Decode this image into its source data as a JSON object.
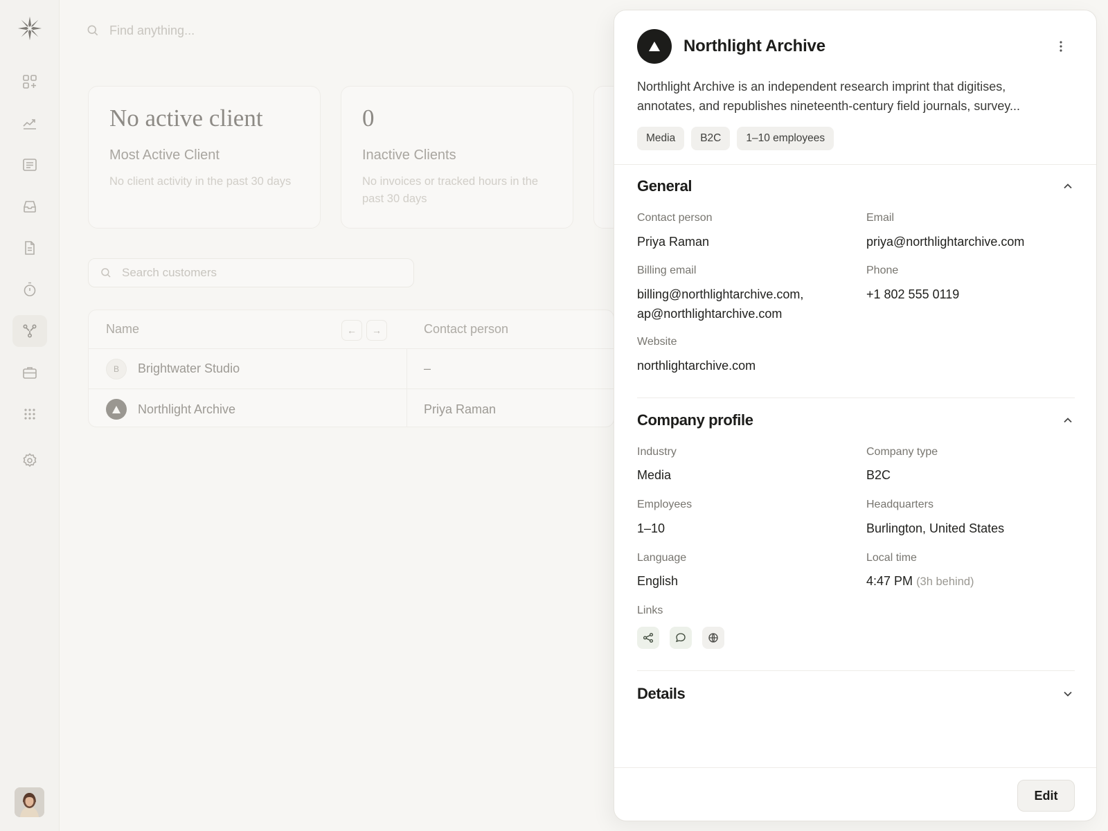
{
  "sidebar": {
    "items": [
      {
        "name": "dashboard",
        "icon": "widgets-icon"
      },
      {
        "name": "reports",
        "icon": "trend-chart-icon"
      },
      {
        "name": "notes",
        "icon": "document-lines-icon"
      },
      {
        "name": "inbox",
        "icon": "inbox-tray-icon"
      },
      {
        "name": "invoices",
        "icon": "file-icon"
      },
      {
        "name": "time-tracking",
        "icon": "stopwatch-icon"
      },
      {
        "name": "customers",
        "icon": "network-nodes-icon",
        "active": true
      },
      {
        "name": "projects",
        "icon": "briefcase-icon"
      },
      {
        "name": "apps",
        "icon": "grid-dots-icon"
      },
      {
        "name": "settings",
        "icon": "gear-icon"
      }
    ]
  },
  "search": {
    "placeholder": "Find anything..."
  },
  "stats": [
    {
      "value": "No active client",
      "label": "Most Active Client",
      "sub": "No client activity in the past 30 days"
    },
    {
      "value": "0",
      "label": "Inactive Clients",
      "sub": "No invoices or tracked hours in the past 30 days"
    }
  ],
  "customers": {
    "search_placeholder": "Search customers",
    "columns": {
      "name": "Name",
      "contact": "Contact person"
    },
    "rows": [
      {
        "avatar": "B",
        "name": "Brightwater Studio",
        "contact": "–"
      },
      {
        "avatar": "",
        "name": "Northlight Archive",
        "contact": "Priya Raman"
      }
    ]
  },
  "panel": {
    "title": "Northlight Archive",
    "description": "Northlight Archive is an independent research imprint that digitises, annotates, and republishes nineteenth-century field journals, survey...",
    "tags": [
      "Media",
      "B2C",
      "1–10 employees"
    ],
    "general": {
      "title": "General",
      "contact_label": "Contact person",
      "contact": "Priya Raman",
      "email_label": "Email",
      "email": "priya@northlightarchive.com",
      "billing_label": "Billing email",
      "billing_1": "billing@northlightarchive.com,",
      "billing_2": "ap@northlightarchive.com",
      "phone_label": "Phone",
      "phone": "+1 802 555 0119",
      "website_label": "Website",
      "website": "northlightarchive.com"
    },
    "profile": {
      "title": "Company profile",
      "industry_label": "Industry",
      "industry": "Media",
      "type_label": "Company type",
      "type": "B2C",
      "employees_label": "Employees",
      "employees": "1–10",
      "hq_label": "Headquarters",
      "hq": "Burlington, United States",
      "language_label": "Language",
      "language": "English",
      "time_label": "Local time",
      "time": "4:47 PM",
      "time_offset": "(3h behind)",
      "links_label": "Links",
      "links": [
        "share-icon",
        "chat-bubble-icon",
        "globe-icon"
      ]
    },
    "details": {
      "title": "Details"
    },
    "edit_label": "Edit"
  }
}
